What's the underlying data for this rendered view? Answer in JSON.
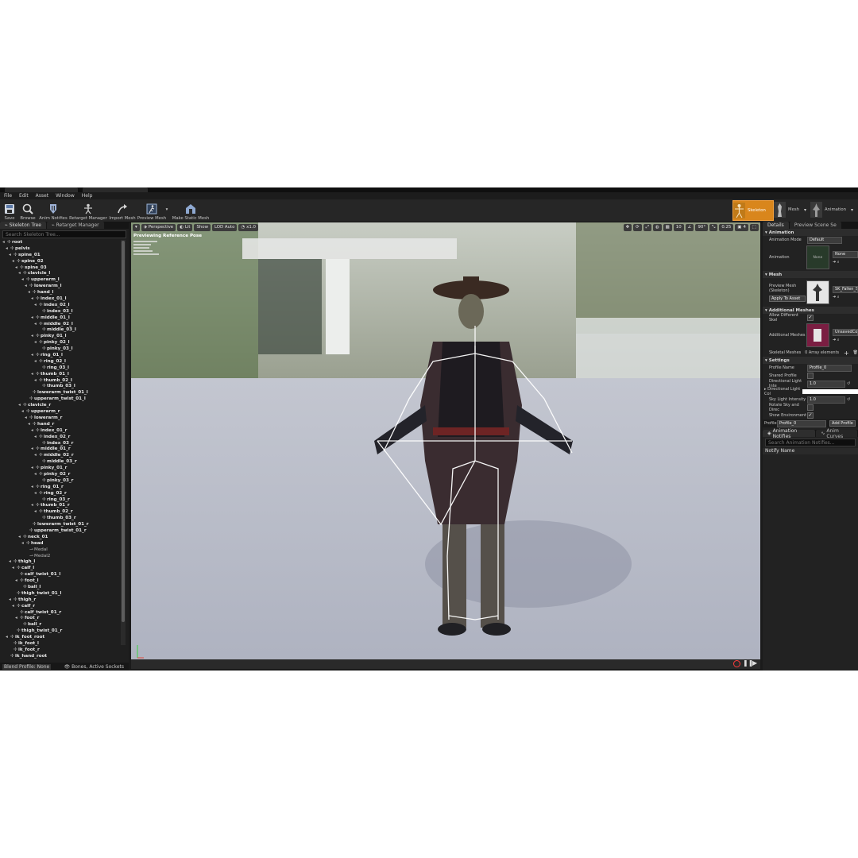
{
  "menu": [
    "File",
    "Edit",
    "Asset",
    "Window",
    "Help"
  ],
  "toolbar": {
    "buttons": [
      "Save",
      "Browse",
      "Anim Notifies",
      "Retarget Manager",
      "Import Mesh",
      "Preview Mesh",
      "Make Static Mesh"
    ],
    "modes": [
      "Skeleton",
      "Mesh",
      "Animation"
    ]
  },
  "left_panel": {
    "tabs": [
      "Skeleton Tree",
      "Retarget Manager"
    ],
    "search_placeholder": "Search Skeleton Tree...",
    "bones": [
      {
        "name": "root",
        "d": 0
      },
      {
        "name": "pelvis",
        "d": 1
      },
      {
        "name": "spine_01",
        "d": 2
      },
      {
        "name": "spine_02",
        "d": 3
      },
      {
        "name": "spine_03",
        "d": 4
      },
      {
        "name": "clavicle_l",
        "d": 5
      },
      {
        "name": "upperarm_l",
        "d": 6
      },
      {
        "name": "lowerarm_l",
        "d": 7
      },
      {
        "name": "hand_l",
        "d": 8
      },
      {
        "name": "index_01_l",
        "d": 9
      },
      {
        "name": "index_02_l",
        "d": 10
      },
      {
        "name": "index_03_l",
        "d": 11
      },
      {
        "name": "middle_01_l",
        "d": 9
      },
      {
        "name": "middle_02_l",
        "d": 10
      },
      {
        "name": "middle_03_l",
        "d": 11
      },
      {
        "name": "pinky_01_l",
        "d": 9
      },
      {
        "name": "pinky_02_l",
        "d": 10
      },
      {
        "name": "pinky_03_l",
        "d": 11
      },
      {
        "name": "ring_01_l",
        "d": 9
      },
      {
        "name": "ring_02_l",
        "d": 10
      },
      {
        "name": "ring_03_l",
        "d": 11
      },
      {
        "name": "thumb_01_l",
        "d": 9
      },
      {
        "name": "thumb_02_l",
        "d": 10
      },
      {
        "name": "thumb_03_l",
        "d": 11
      },
      {
        "name": "lowerarm_twist_01_l",
        "d": 8
      },
      {
        "name": "upperarm_twist_01_l",
        "d": 7
      },
      {
        "name": "clavicle_r",
        "d": 5
      },
      {
        "name": "upperarm_r",
        "d": 6
      },
      {
        "name": "lowerarm_r",
        "d": 7
      },
      {
        "name": "hand_r",
        "d": 8
      },
      {
        "name": "index_01_r",
        "d": 9
      },
      {
        "name": "index_02_r",
        "d": 10
      },
      {
        "name": "index_03_r",
        "d": 11
      },
      {
        "name": "middle_01_r",
        "d": 9
      },
      {
        "name": "middle_02_r",
        "d": 10
      },
      {
        "name": "middle_03_r",
        "d": 11
      },
      {
        "name": "pinky_01_r",
        "d": 9
      },
      {
        "name": "pinky_02_r",
        "d": 10
      },
      {
        "name": "pinky_03_r",
        "d": 11
      },
      {
        "name": "ring_01_r",
        "d": 9
      },
      {
        "name": "ring_02_r",
        "d": 10
      },
      {
        "name": "ring_03_r",
        "d": 11
      },
      {
        "name": "thumb_01_r",
        "d": 9
      },
      {
        "name": "thumb_02_r",
        "d": 10
      },
      {
        "name": "thumb_03_r",
        "d": 11
      },
      {
        "name": "lowerarm_twist_01_r",
        "d": 8
      },
      {
        "name": "upperarm_twist_01_r",
        "d": 7
      },
      {
        "name": "neck_01",
        "d": 5
      },
      {
        "name": "head",
        "d": 6
      },
      {
        "name": "Medal",
        "d": 7,
        "socket": true
      },
      {
        "name": "Medal2",
        "d": 7,
        "socket": true
      },
      {
        "name": "thigh_l",
        "d": 2
      },
      {
        "name": "calf_l",
        "d": 3
      },
      {
        "name": "calf_twist_01_l",
        "d": 4
      },
      {
        "name": "foot_l",
        "d": 4
      },
      {
        "name": "ball_l",
        "d": 5
      },
      {
        "name": "thigh_twist_01_l",
        "d": 3
      },
      {
        "name": "thigh_r",
        "d": 2
      },
      {
        "name": "calf_r",
        "d": 3
      },
      {
        "name": "calf_twist_01_r",
        "d": 4
      },
      {
        "name": "foot_r",
        "d": 4
      },
      {
        "name": "ball_r",
        "d": 5
      },
      {
        "name": "thigh_twist_01_r",
        "d": 3
      },
      {
        "name": "ik_foot_root",
        "d": 1
      },
      {
        "name": "ik_foot_l",
        "d": 2
      },
      {
        "name": "ik_foot_r",
        "d": 2
      },
      {
        "name": "ik_hand_root",
        "d": 1
      }
    ],
    "blend_profile": "Blend Profile: None",
    "bones_filter": "Bones, Active Sockets"
  },
  "viewport": {
    "perspective_label": "Perspective",
    "lit_label": "Lit",
    "show_label": "Show",
    "lod_label": "LOD Auto",
    "speed_label": "x1.0",
    "overlay_title": "Previewing Reference Pose",
    "grid_snap": "10",
    "rot_snap": "90°",
    "scale_snap": "0.25",
    "cam_speed": "4"
  },
  "right_panel": {
    "tabs": [
      "Details",
      "Preview Scene Se"
    ],
    "animation_section": "Animation",
    "animation_mode_label": "Animation Mode",
    "animation_mode_value": "Default",
    "animation_label": "Animation",
    "animation_value": "None",
    "animation_thumb": "None",
    "mesh_section": "Mesh",
    "preview_mesh_label": "Preview Mesh (Skeleton)",
    "apply_to_asset": "Apply To Asset",
    "mesh_value": "SK_Fallen_S",
    "additional_section": "Additional Meshes",
    "allow_different_label": "Allow Different Skel",
    "additional_meshes_label": "Additional Meshes",
    "additional_meshes_value": "UnsavedColl",
    "skeletal_meshes_label": "Skeletal Meshes",
    "skeletal_meshes_value": "0 Array elements",
    "settings_section": "Settings",
    "profile_name_label": "Profile Name",
    "profile_name_value": "Profile_0",
    "shared_profile_label": "Shared Profile",
    "dir_light_int_label": "Directional Light Inte",
    "dir_light_int_value": "1.0",
    "dir_light_col_label": "Directional Light Col",
    "sky_light_label": "Sky Light Intensity",
    "sky_light_value": "1.0",
    "rotate_sky_label": "Rotate Sky and Direc",
    "show_env_label": "Show Environment",
    "profile_label": "Profile",
    "profile_value": "Profile_0",
    "add_profile": "Add Profile",
    "bottom_tabs": [
      "Animation Notifies",
      "Anim Curves"
    ],
    "notifies_search": "Search Animation Notifies...",
    "notify_name_header": "Notify Name"
  },
  "colors": {
    "accent": "#e08a1e",
    "bg": "#1b1b1b",
    "panel": "#222222"
  }
}
